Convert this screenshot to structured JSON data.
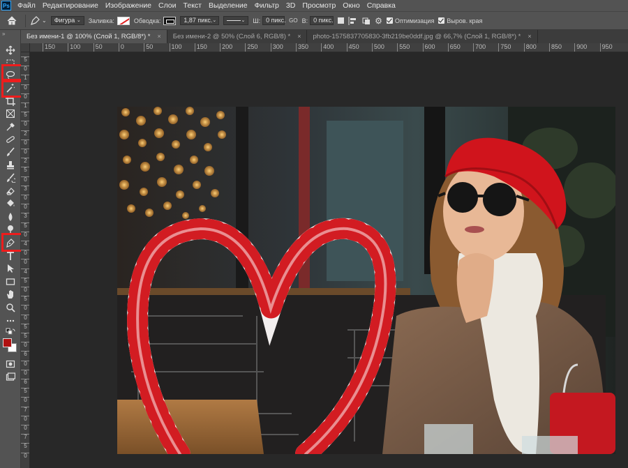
{
  "app": {
    "logo_text": "Ps"
  },
  "menu": [
    "Файл",
    "Редактирование",
    "Изображение",
    "Слои",
    "Текст",
    "Выделение",
    "Фильтр",
    "3D",
    "Просмотр",
    "Окно",
    "Справка"
  ],
  "options_bar": {
    "mode_value": "Фигура",
    "fill_label": "Заливка:",
    "stroke_label": "Обводка:",
    "stroke_width_value": "1,87 пикс.",
    "width_label": "Ш:",
    "width_value": "0 пикс.",
    "link_label": "GO",
    "height_label": "В:",
    "height_value": "0 пикс.",
    "optimize_label": "Оптимизация",
    "align_edges_label": "Выров. края"
  },
  "tabs": [
    {
      "label": "Без имени-1 @ 100% (Слой 1, RGB/8*) *",
      "active": true
    },
    {
      "label": "Без имени-2 @ 50% (Слой 6, RGB/8) *",
      "active": false
    },
    {
      "label": "photo-1575837705830-3fb219be0ddf.jpg @ 66,7% (Слой 1, RGB/8*) *",
      "active": false
    }
  ],
  "tab_close_glyph": "×",
  "ruler_h": [
    "150",
    "100",
    "50",
    "0",
    "50",
    "100",
    "150",
    "200",
    "250",
    "300",
    "350",
    "400",
    "450",
    "500",
    "550",
    "600",
    "650",
    "700",
    "750",
    "800",
    "850",
    "900",
    "950"
  ],
  "ruler_v": [
    "5",
    "0",
    "1",
    "0",
    "0",
    "1",
    "5",
    "0",
    "2",
    "0",
    "0",
    "2",
    "5",
    "0",
    "3",
    "0",
    "0",
    "3",
    "5",
    "0",
    "4",
    "0",
    "0",
    "4",
    "5",
    "0",
    "5",
    "0",
    "0",
    "5",
    "5",
    "0",
    "6",
    "0",
    "0",
    "6",
    "5",
    "0",
    "7",
    "0",
    "0",
    "7",
    "5",
    "0"
  ],
  "colors": {
    "foreground": "#b01010",
    "background": "#ffffff",
    "highlight": "#ee1c1c"
  },
  "tools": [
    "move-icon",
    "marquee-icon",
    "lasso-icon",
    "magic-wand-icon",
    "crop-icon",
    "frame-icon",
    "eyedropper-icon",
    "healing-icon",
    "brush-icon",
    "stamp-icon",
    "history-brush-icon",
    "eraser-icon",
    "paint-bucket-icon",
    "blur-icon",
    "dodge-icon",
    "pen-icon",
    "type-icon",
    "path-select-icon",
    "rectangle-icon",
    "hand-icon",
    "zoom-icon",
    "more-icon"
  ]
}
